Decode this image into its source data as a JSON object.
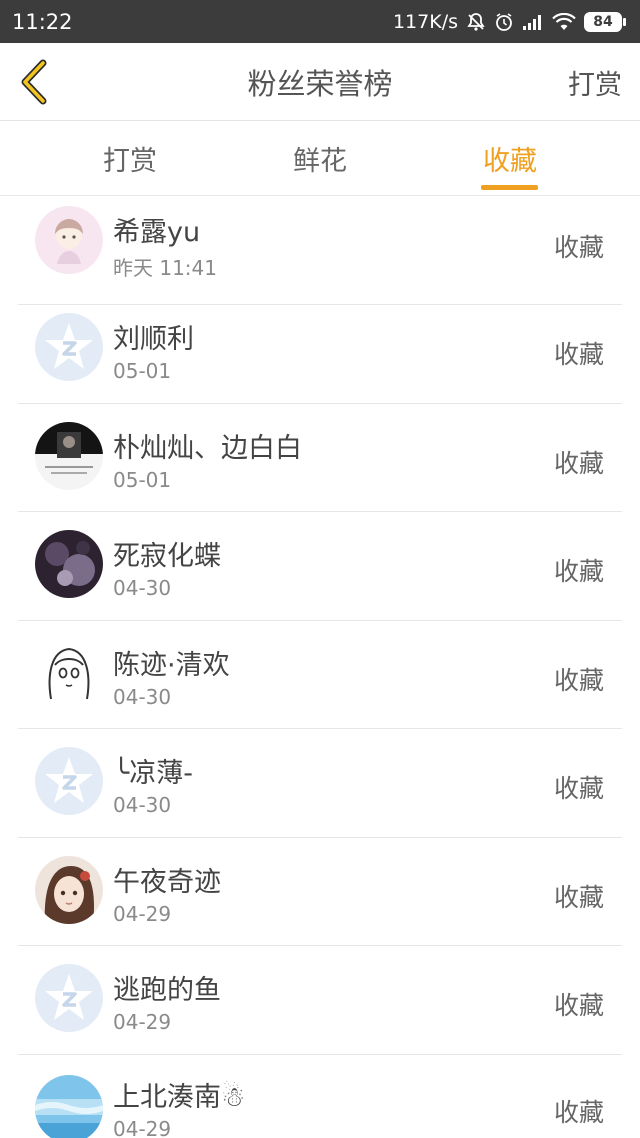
{
  "status_bar": {
    "time": "11:22",
    "network_speed": "117K/s",
    "battery": "84",
    "icons": [
      "mute-bell-icon",
      "alarm-icon",
      "signal-icon",
      "wifi-icon",
      "battery-icon"
    ]
  },
  "nav": {
    "back_icon": "chevron-left-icon",
    "title": "粉丝荣誉榜",
    "action": "打赏"
  },
  "tabs": [
    {
      "label": "打赏",
      "active": false
    },
    {
      "label": "鲜花",
      "active": false
    },
    {
      "label": "收藏",
      "active": true
    }
  ],
  "accent_color": "#f0a020",
  "list": [
    {
      "name": "希露yu",
      "date": "昨天 11:41",
      "action": "收藏",
      "avatar": "anime-avatar-pink"
    },
    {
      "name": "刘顺利",
      "date": "05-01",
      "action": "收藏",
      "avatar": "qq-default-avatar"
    },
    {
      "name": "朴灿灿、边白白",
      "date": "05-01",
      "action": "收藏",
      "avatar": "photo-avatar-dark"
    },
    {
      "name": "死寂化蝶",
      "date": "04-30",
      "action": "收藏",
      "avatar": "photo-avatar-purple"
    },
    {
      "name": "陈迹·清欢",
      "date": "04-30",
      "action": "收藏",
      "avatar": "sketch-girl-avatar"
    },
    {
      "name": "╰凉薄-",
      "date": "04-30",
      "action": "收藏",
      "avatar": "qq-default-avatar"
    },
    {
      "name": "午夜奇迹",
      "date": "04-29",
      "action": "收藏",
      "avatar": "anime-girl-avatar"
    },
    {
      "name": "逃跑的鱼",
      "date": "04-29",
      "action": "收藏",
      "avatar": "qq-default-avatar"
    },
    {
      "name": "上北湊南☃",
      "date": "04-29",
      "action": "收藏",
      "avatar": "sky-photo-avatar"
    }
  ]
}
